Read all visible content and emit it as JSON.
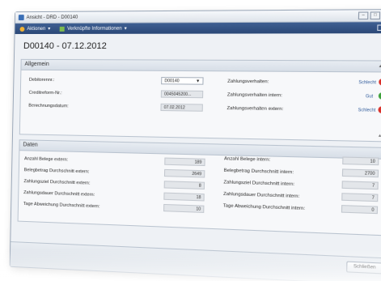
{
  "window": {
    "title": "Ansicht - DRD - D00140"
  },
  "toolbar": {
    "actions_label": "Aktionen",
    "linked_label": "Verknüpfte Informationen"
  },
  "heading": "D00140 - 07.12.2012",
  "general": {
    "title": "Allgemein",
    "debtor_label": "Debitorennr.:",
    "debtor_value": "D00140",
    "creditreform_label": "Creditreform-Nr.:",
    "creditreform_value": "0045045200...",
    "calc_date_label": "Berechnungsdatum:",
    "calc_date_value": "07.02.2012",
    "payment_behavior_label": "Zahlungsverhalten:",
    "payment_behavior_status": "Schlecht",
    "payment_internal_label": "Zahlungsverhalten intern:",
    "payment_internal_status": "Gut",
    "payment_external_label": "Zahlungsverhalten extern:",
    "payment_external_status": "Schlecht",
    "colors": {
      "bad": "#d9312a",
      "good": "#3da13a"
    }
  },
  "data": {
    "title": "Daten",
    "left": [
      {
        "label": "Anzahl Belege extern:",
        "value": "189"
      },
      {
        "label": "Belegbetrag Durchschnitt extern:",
        "value": "2649"
      },
      {
        "label": "Zahlungsziel Durchschnitt extern:",
        "value": "8"
      },
      {
        "label": "Zahlungsdauer Durchschnitt extern:",
        "value": "18"
      },
      {
        "label": "Tage Abweichung Durchschnitt extern:",
        "value": "10"
      }
    ],
    "right": [
      {
        "label": "Anzahl Belege intern:",
        "value": "10"
      },
      {
        "label": "Belegbetrag Durchschnitt intern:",
        "value": "2700"
      },
      {
        "label": "Zahlungsziel Durchschnitt intern:",
        "value": "7"
      },
      {
        "label": "Zahlungsdauer Durchschnitt intern:",
        "value": "7"
      },
      {
        "label": "Tage Abweichung Durchschnitt intern:",
        "value": "0"
      }
    ]
  },
  "footer": {
    "close_label": "Schließen"
  }
}
